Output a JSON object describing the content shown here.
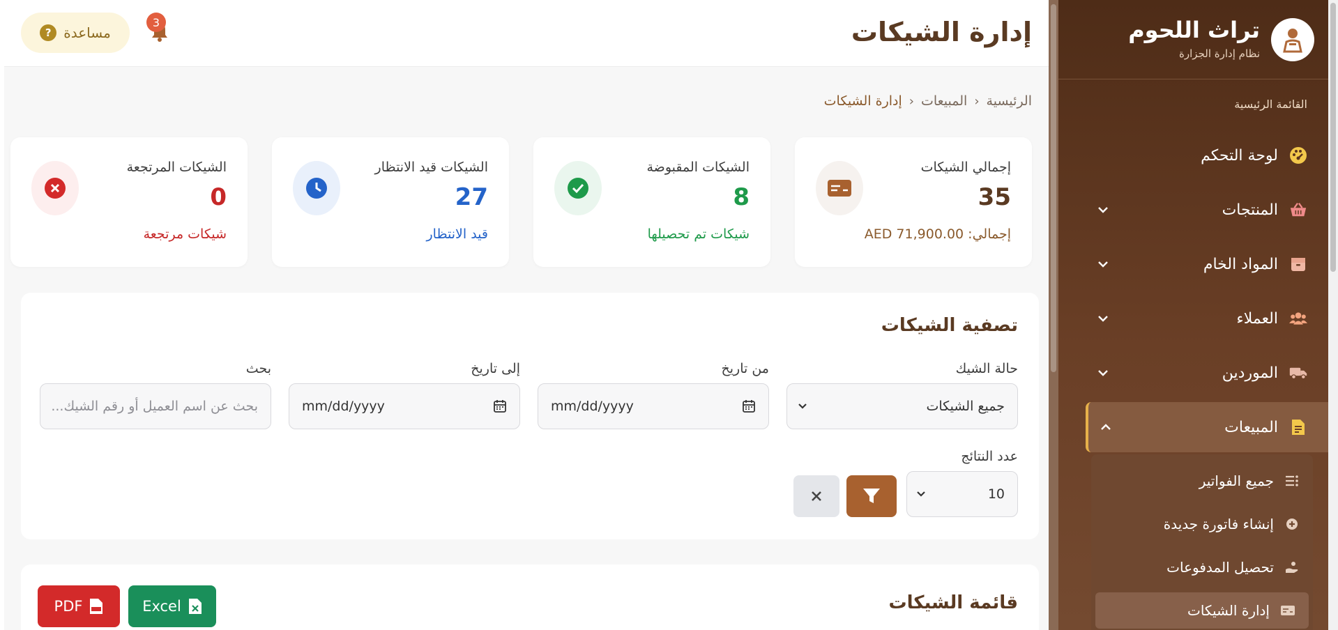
{
  "app": {
    "name": "تراث اللحوم",
    "subtitle": "نظام إدارة الجزارة"
  },
  "sidebar": {
    "heading": "القائمة الرئيسية",
    "items": [
      {
        "label": "لوحة التحكم",
        "icon": "dashboard-icon"
      },
      {
        "label": "المنتجات",
        "icon": "basket-icon"
      },
      {
        "label": "المواد الخام",
        "icon": "box-icon"
      },
      {
        "label": "العملاء",
        "icon": "users-icon"
      },
      {
        "label": "الموردين",
        "icon": "truck-icon"
      },
      {
        "label": "المبيعات",
        "icon": "invoice-icon"
      }
    ],
    "sales_sub": [
      {
        "label": "جميع الفواتير",
        "icon": "list-icon"
      },
      {
        "label": "إنشاء فاتورة جديدة",
        "icon": "plus-circle-icon"
      },
      {
        "label": "تحصيل المدفوعات",
        "icon": "hand-coin-icon"
      },
      {
        "label": "إدارة الشيكات",
        "icon": "check-card-icon"
      }
    ]
  },
  "header": {
    "title": "إدارة الشيكات",
    "help_label": "مساعدة",
    "notification_count": "3"
  },
  "breadcrumb": [
    "الرئيسية",
    "المبيعات",
    "إدارة الشيكات"
  ],
  "stats": [
    {
      "label": "إجمالي الشيكات",
      "value": "35",
      "note": "إجمالي: AED 71,900.00",
      "color": "#5a3a22",
      "note_color": "#8a5a2c"
    },
    {
      "label": "الشيكات المقبوضة",
      "value": "8",
      "note": "شيكات تم تحصيلها",
      "color": "#1e9a4a",
      "note_color": "#1e9a4a"
    },
    {
      "label": "الشيكات قيد الانتظار",
      "value": "27",
      "note": "قيد الانتظار",
      "color": "#2463c9",
      "note_color": "#2463c9"
    },
    {
      "label": "الشيكات المرتجعة",
      "value": "0",
      "note": "شيكات مرتجعة",
      "color": "#c62828",
      "note_color": "#c62828"
    }
  ],
  "filter": {
    "title": "تصفية الشيكات",
    "status_label": "حالة الشيك",
    "status_value": "جميع الشيكات",
    "from_label": "من تاريخ",
    "from_value": "mm/dd/yyyy",
    "to_label": "إلى تاريخ",
    "to_value": "mm/dd/yyyy",
    "search_label": "بحث",
    "search_placeholder": "بحث عن اسم العميل أو رقم الشيك...",
    "count_label": "عدد النتائج",
    "count_value": "10"
  },
  "list": {
    "title": "قائمة الشيكات",
    "excel_label": "Excel",
    "pdf_label": "PDF"
  },
  "colors": {
    "accent": "#a8612f",
    "sidebar": "#5a341e",
    "excel": "#1a8f5a",
    "pdf": "#d32a2a"
  }
}
